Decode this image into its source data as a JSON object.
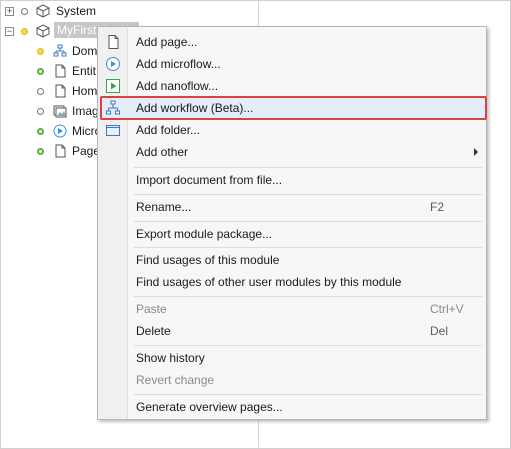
{
  "tree": {
    "items": [
      {
        "label": "System"
      },
      {
        "label": "MyFirstModule"
      },
      {
        "label": "Dom"
      },
      {
        "label": "Entit"
      },
      {
        "label": "Hom"
      },
      {
        "label": "Imag"
      },
      {
        "label": "Micro"
      },
      {
        "label": "Page"
      }
    ]
  },
  "menu": {
    "add_page": "Add page...",
    "add_microflow": "Add microflow...",
    "add_nanoflow": "Add nanoflow...",
    "add_workflow": "Add workflow (Beta)...",
    "add_folder": "Add folder...",
    "add_other": "Add other",
    "import_document": "Import document from file...",
    "rename": "Rename...",
    "rename_shortcut": "F2",
    "export_module": "Export module package...",
    "find_usages": "Find usages of this module",
    "find_usages_other": "Find usages of other user modules by this module",
    "paste": "Paste",
    "paste_shortcut": "Ctrl+V",
    "delete": "Delete",
    "delete_shortcut": "Del",
    "show_history": "Show history",
    "revert_change": "Revert change",
    "generate_overview": "Generate overview pages..."
  },
  "colors": {
    "highlight_border": "#e0403f",
    "selection_bg": "#c7c7c7",
    "status_green": "#55b23b",
    "status_yellow": "#f2d64b"
  }
}
